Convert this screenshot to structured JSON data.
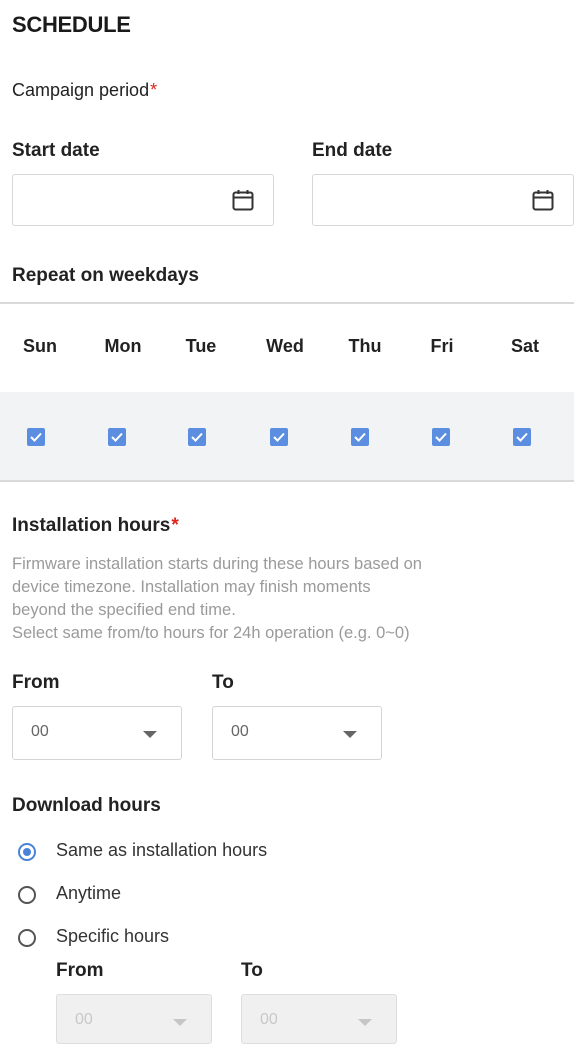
{
  "schedule": {
    "title": "SCHEDULE",
    "campaign_period_label": "Campaign period",
    "required_mark": "*",
    "start_date_label": "Start date",
    "end_date_label": "End date",
    "start_date_value": "",
    "end_date_value": ""
  },
  "weekdays": {
    "label": "Repeat on weekdays",
    "days": [
      {
        "name": "Sun",
        "checked": true
      },
      {
        "name": "Mon",
        "checked": true
      },
      {
        "name": "Tue",
        "checked": true
      },
      {
        "name": "Wed",
        "checked": true
      },
      {
        "name": "Thu",
        "checked": true
      },
      {
        "name": "Fri",
        "checked": true
      },
      {
        "name": "Sat",
        "checked": true
      }
    ]
  },
  "installation": {
    "label": "Installation hours",
    "help_lines": [
      "Firmware installation starts during these hours based on",
      "device timezone. Installation may finish moments",
      "beyond the specified end time.",
      "Select same from/to hours for 24h operation (e.g. 0~0)"
    ],
    "from_label": "From",
    "to_label": "To",
    "from_value": "00",
    "to_value": "00"
  },
  "download": {
    "label": "Download hours",
    "options": [
      {
        "label": "Same as installation hours",
        "selected": true
      },
      {
        "label": "Anytime",
        "selected": false
      },
      {
        "label": "Specific hours",
        "selected": false
      }
    ],
    "from_label": "From",
    "to_label": "To",
    "from_value": "00",
    "to_value": "00"
  },
  "colors": {
    "accent": "#4a82d9",
    "checkbox": "#5b8ee0",
    "required": "#e0241b"
  }
}
